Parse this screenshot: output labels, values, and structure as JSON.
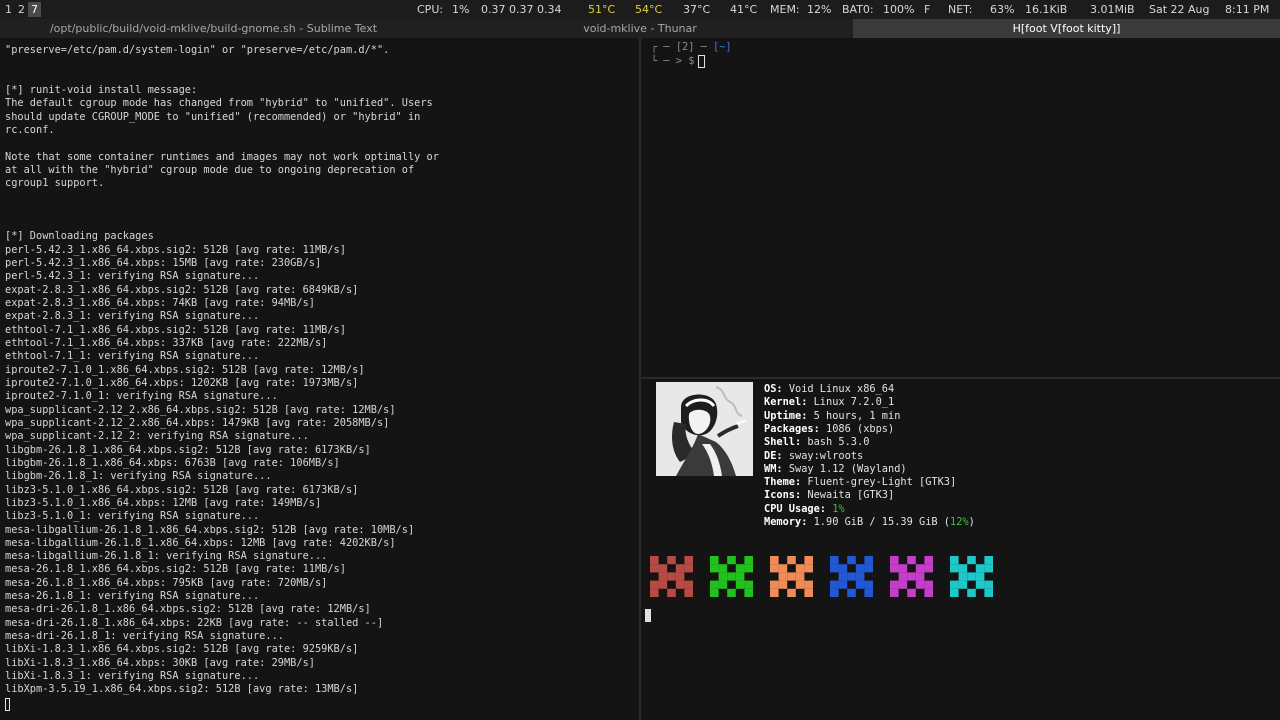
{
  "statusbar": {
    "workspaces": [
      "1",
      "2",
      "7"
    ],
    "active_workspace": "7",
    "cpu_label": "CPU:",
    "cpu_value": "1%",
    "load": "0.37 0.37 0.34",
    "temps": [
      "51°C",
      "54°C",
      "37°C",
      "41°C"
    ],
    "mem_label": "MEM:",
    "mem_value": "12%",
    "bat_label": "BAT0:",
    "bat_value": "100%",
    "bat_state": "F",
    "net_label": "NET:",
    "net_signal": "63%",
    "net_down": "16.1KiB",
    "net_up": "3.01MiB",
    "date": "Sat 22 Aug",
    "time": "8:11 PM"
  },
  "titles": {
    "left": "/opt/public/build/void-mklive/build-gnome.sh - Sublime Text",
    "middle": "void-mklive - Thunar",
    "right": "H[foot V[foot kitty]]"
  },
  "left_terminal": {
    "lines": [
      "\"preserve=/etc/pam.d/system-login\" or \"preserve=/etc/pam.d/*\".",
      "",
      "",
      "[*] runit-void install message:",
      "The default cgroup mode has changed from \"hybrid\" to \"unified\". Users",
      "should update CGROUP_MODE to \"unified\" (recommended) or \"hybrid\" in",
      "rc.conf.",
      "",
      "Note that some container runtimes and images may not work optimally or",
      "at all with the \"hybrid\" cgroup mode due to ongoing deprecation of",
      "cgroup1 support.",
      "",
      "",
      "",
      "[*] Downloading packages",
      "perl-5.42.3_1.x86_64.xbps.sig2: 512B [avg rate: 11MB/s]",
      "perl-5.42.3_1.x86_64.xbps: 15MB [avg rate: 230GB/s]",
      "perl-5.42.3_1: verifying RSA signature...",
      "expat-2.8.3_1.x86_64.xbps.sig2: 512B [avg rate: 6849KB/s]",
      "expat-2.8.3_1.x86_64.xbps: 74KB [avg rate: 94MB/s]",
      "expat-2.8.3_1: verifying RSA signature...",
      "ethtool-7.1_1.x86_64.xbps.sig2: 512B [avg rate: 11MB/s]",
      "ethtool-7.1_1.x86_64.xbps: 337KB [avg rate: 222MB/s]",
      "ethtool-7.1_1: verifying RSA signature...",
      "iproute2-7.1.0_1.x86_64.xbps.sig2: 512B [avg rate: 12MB/s]",
      "iproute2-7.1.0_1.x86_64.xbps: 1202KB [avg rate: 1973MB/s]",
      "iproute2-7.1.0_1: verifying RSA signature...",
      "wpa_supplicant-2.12_2.x86_64.xbps.sig2: 512B [avg rate: 12MB/s]",
      "wpa_supplicant-2.12_2.x86_64.xbps: 1479KB [avg rate: 2058MB/s]",
      "wpa_supplicant-2.12_2: verifying RSA signature...",
      "libgbm-26.1.8_1.x86_64.xbps.sig2: 512B [avg rate: 6173KB/s]",
      "libgbm-26.1.8_1.x86_64.xbps: 6763B [avg rate: 106MB/s]",
      "libgbm-26.1.8_1: verifying RSA signature...",
      "libz3-5.1.0_1.x86_64.xbps.sig2: 512B [avg rate: 6173KB/s]",
      "libz3-5.1.0_1.x86_64.xbps: 12MB [avg rate: 149MB/s]",
      "libz3-5.1.0_1: verifying RSA signature...",
      "mesa-libgallium-26.1.8_1.x86_64.xbps.sig2: 512B [avg rate: 10MB/s]",
      "mesa-libgallium-26.1.8_1.x86_64.xbps: 12MB [avg rate: 4202KB/s]",
      "mesa-libgallium-26.1.8_1: verifying RSA signature...",
      "mesa-26.1.8_1.x86_64.xbps.sig2: 512B [avg rate: 11MB/s]",
      "mesa-26.1.8_1.x86_64.xbps: 795KB [avg rate: 720MB/s]",
      "mesa-26.1.8_1: verifying RSA signature...",
      "mesa-dri-26.1.8_1.x86_64.xbps.sig2: 512B [avg rate: 12MB/s]",
      "mesa-dri-26.1.8_1.x86_64.xbps: 22KB [avg rate: -- stalled --]",
      "mesa-dri-26.1.8_1: verifying RSA signature...",
      "libXi-1.8.3_1.x86_64.xbps.sig2: 512B [avg rate: 9259KB/s]",
      "libXi-1.8.3_1.x86_64.xbps: 30KB [avg rate: 29MB/s]",
      "libXi-1.8.3_1: verifying RSA signature...",
      "libXpm-3.5.19_1.x86_64.xbps.sig2: 512B [avg rate: 13MB/s]"
    ]
  },
  "prompt": {
    "top_dash": "─",
    "job_count": "[2]",
    "sep": "─",
    "cwd": "[~]",
    "bottom": "─ > $"
  },
  "fetch": {
    "items": [
      {
        "key": "OS:",
        "value": "Void Linux x86_64"
      },
      {
        "key": "Kernel:",
        "value": "Linux 7.2.0_1"
      },
      {
        "key": "Uptime:",
        "value": "5 hours, 1 min"
      },
      {
        "key": "Packages:",
        "value": "1086 (xbps)"
      },
      {
        "key": "Shell:",
        "value": "bash 5.3.0"
      },
      {
        "key": "DE:",
        "value": "sway:wlroots"
      },
      {
        "key": "WM:",
        "value": "Sway 1.12 (Wayland)"
      },
      {
        "key": "Theme:",
        "value": "Fluent-grey-Light [GTK3]"
      },
      {
        "key": "Icons:",
        "value": "Newaita [GTK3]"
      },
      {
        "key": "CPU Usage:",
        "value": "1%"
      }
    ],
    "memory_key": "Memory:",
    "memory_value": "1.90 GiB / 15.39 GiB (",
    "memory_pct": "12%",
    "memory_close": ")",
    "palette": [
      "#b84a44",
      "#22c21c",
      "#f08a56",
      "#2158d6",
      "#c53dc8",
      "#1ec8c8"
    ]
  }
}
